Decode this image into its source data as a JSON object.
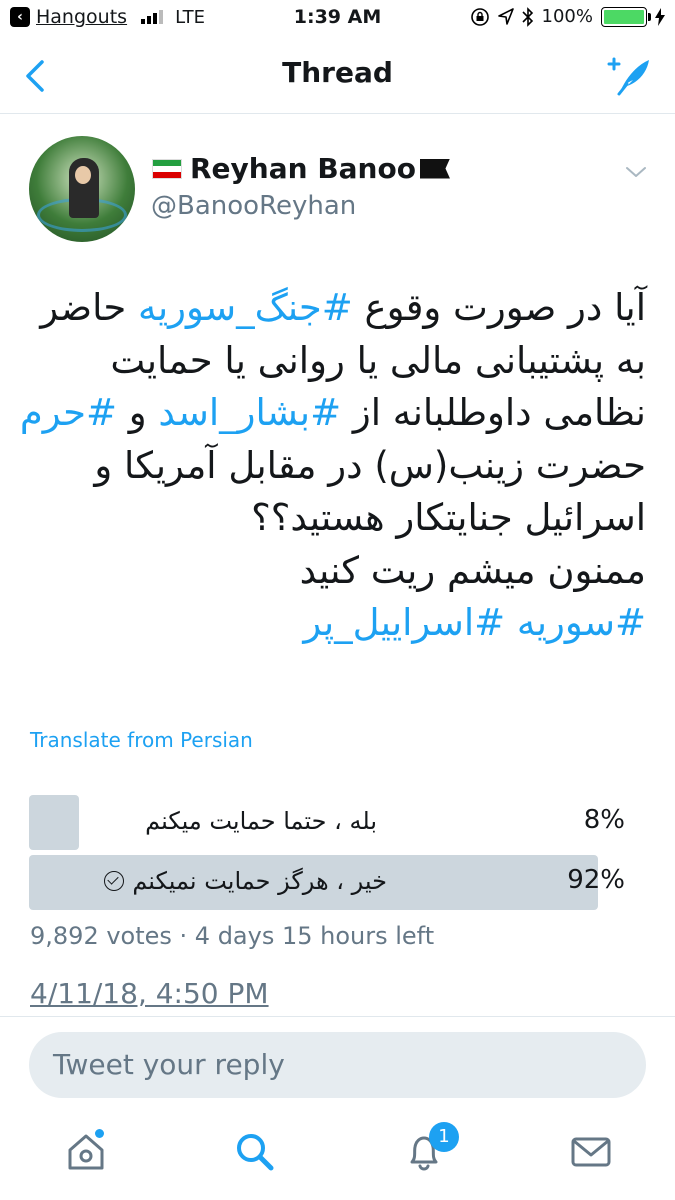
{
  "status_bar": {
    "app": "Hangouts",
    "network": "LTE",
    "time": "1:39 AM",
    "battery": "100%"
  },
  "nav": {
    "title": "Thread"
  },
  "tweet": {
    "name": "Reyhan Banoo",
    "handle": "@BanooReyhan",
    "body": {
      "l1_a": "آیا در صورت وقوع ",
      "l1_tag": "#جنگ_سوریه",
      "l1_b": " حاضر",
      "l2": "به پشتیبانی مالی یا روانی یا حمایت",
      "l3_a": "نظامی داوطلبانه از ",
      "l3_tag": "#بشار_اسد",
      "l3_b": " و ",
      "l3_tag2": "#حرم",
      "l4": "حضرت زینب(س) در مقابل آمریکا و",
      "l5": "اسرائیل جنایتکار هستید؟؟",
      "l6": "ممنون میشم ریت کنید",
      "l7_tag": "#سوریه",
      "l7_sep": " ",
      "l7_tag2": "#اسراییل_پر"
    },
    "translate": "Translate from Persian",
    "poll": {
      "options": [
        {
          "label": "بله ، حتما حمایت میکنم",
          "percent": "8%",
          "fraction": 0.08
        },
        {
          "label": "خیر ، هرگز حمایت نمیکنم",
          "percent": "92%",
          "fraction": 0.92,
          "selected": true
        }
      ],
      "meta": "9,892 votes · 4 days 15 hours left"
    },
    "timestamp": "4/11/18, 4:50 PM"
  },
  "reply": {
    "placeholder": "Tweet your reply"
  },
  "tabbar": {
    "notifications_badge": "1"
  },
  "colors": {
    "accent": "#1da1f2",
    "muted": "#657786",
    "poll_bar": "#ccd6dd"
  }
}
